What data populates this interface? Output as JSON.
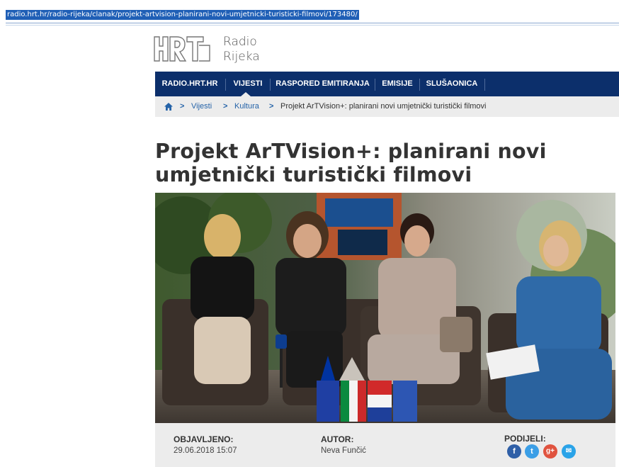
{
  "browser": {
    "url": "radio.hrt.hr/radio-rijeka/clanak/projekt-artvision-planirani-novi-umjetnicki-turisticki-filmovi/173480/"
  },
  "header": {
    "logo_line1": "Radio",
    "logo_line2": "Rijeka",
    "logo_icon": "hrt-logo-icon"
  },
  "nav": {
    "items": [
      {
        "label": "RADIO.HRT.HR"
      },
      {
        "label": "VIJESTI"
      },
      {
        "label": "RASPORED EMITIRANJA"
      },
      {
        "label": "EMISIJE"
      },
      {
        "label": "SLUŠAONICA"
      }
    ],
    "active": "VIJESTI"
  },
  "breadcrumb": {
    "home_icon": "home-icon",
    "items": [
      "Vijesti",
      "Kultura"
    ],
    "current": "Projekt ArTVision+: planirani novi umjetnički turistički filmovi",
    "separator": ">"
  },
  "article": {
    "title": "Projekt ArTVision+: planirani novi umjetnički turistički filmovi",
    "image_alt_icon": "press-conference-photo",
    "published_label": "OBJAVLJENO",
    "published_value": "29.06.2018 15:07",
    "author_label": "AUTOR",
    "author_value": "Neva Funčić",
    "share_label": "PODIJELI",
    "share_buttons": [
      {
        "icon": "facebook-icon",
        "glyph": "f",
        "color": "#2f5fa7"
      },
      {
        "icon": "twitter-icon",
        "glyph": "t",
        "color": "#3b9ee6"
      },
      {
        "icon": "google-plus-icon",
        "glyph": "g+",
        "color": "#e0533f"
      },
      {
        "icon": "email-icon",
        "glyph": "✉",
        "color": "#2aa3e8"
      }
    ]
  },
  "colors": {
    "nav_bg": "#0c2f6b",
    "breadcrumb_bg": "#ececec",
    "link": "#2563a8",
    "url_highlight": "#1f5fb6"
  }
}
